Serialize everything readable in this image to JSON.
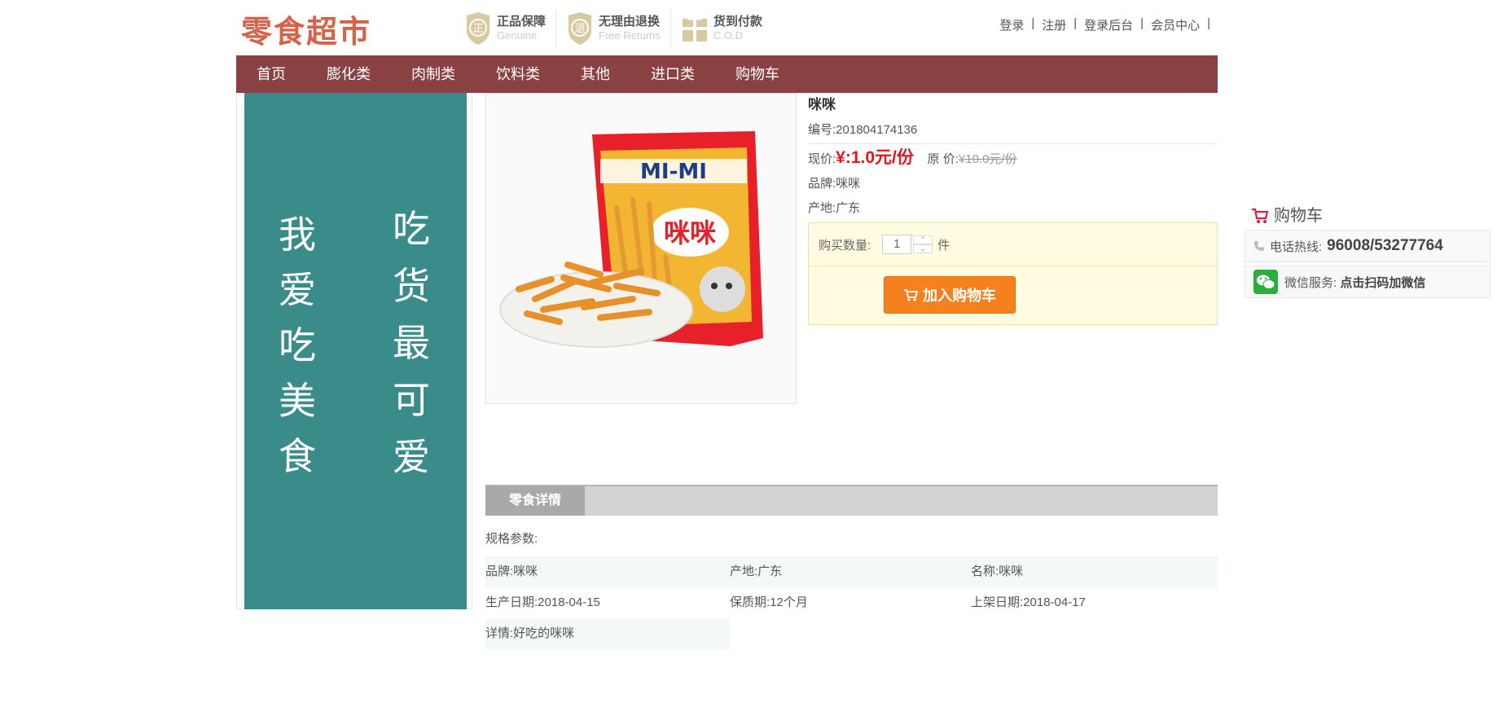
{
  "header": {
    "logo": "零食超市",
    "guarantees": [
      {
        "zh": "正品保障",
        "en": "Genuine",
        "icon": "genuine-shield-icon"
      },
      {
        "zh": "无理由退换",
        "en": "Free Returns",
        "icon": "returns-shield-icon"
      },
      {
        "zh": "货到付款",
        "en": "C.O.D",
        "icon": "gift-box-icon"
      }
    ],
    "toplinks": [
      "登录",
      "注册",
      "登录后台",
      "会员中心"
    ],
    "separator": "|"
  },
  "nav": [
    "首页",
    "膨化类",
    "肉制类",
    "饮料类",
    "其他",
    "进口类",
    "购物车"
  ],
  "banner": {
    "col1": [
      "我",
      "爱",
      "吃",
      "美",
      "食"
    ],
    "col2": [
      "吃",
      "货",
      "最",
      "可",
      "爱"
    ]
  },
  "product": {
    "name": "咪咪",
    "code": "编号:201804174136",
    "now_label": "现价:",
    "now_price": "¥:1.0元/份",
    "orig_label": "原 价:",
    "orig_price": "¥10.0元/份",
    "brand": "品牌:咪咪",
    "origin": "产地:广东",
    "image_bag_brand": "MI-MI",
    "image_bag_name": "咪咪"
  },
  "buy": {
    "qty_label": "购买数量:",
    "qty_value": "1",
    "unit": "件",
    "add_cart": "加入购物车"
  },
  "details": {
    "tab": "零食详情",
    "spec_title": "规格参数:",
    "rows": [
      [
        "品牌:咪咪",
        "产地:广东",
        "名称:咪咪"
      ],
      [
        "生产日期:2018-04-15",
        "保质期:12个月",
        "上架日期:2018-04-17"
      ],
      [
        "详情:好吃的咪咪"
      ]
    ]
  },
  "sidebar": {
    "cart": "购物车",
    "hotline_label": "电话热线:",
    "hotline_number": "96008/53277764",
    "wechat_label": "微信服务:",
    "wechat_link": "点击扫码加微信"
  },
  "colors": {
    "nav_bg": "#8a4142",
    "banner_bg": "#3a8c8b",
    "price_red": "#e4161c",
    "button_orange": "#f5801e"
  }
}
